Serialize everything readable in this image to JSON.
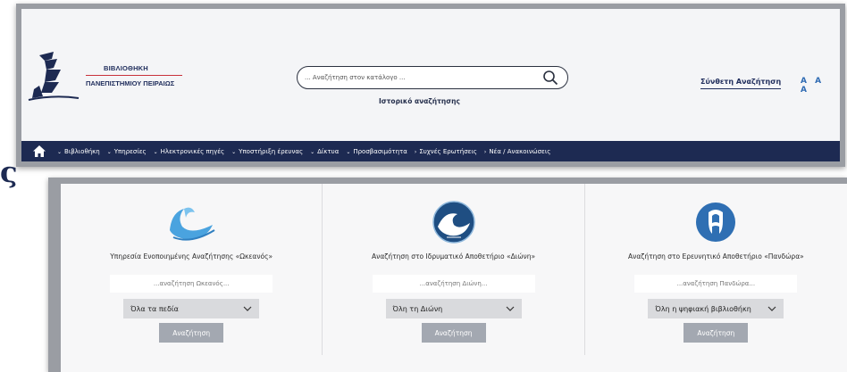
{
  "header": {
    "logo_line1": "ΒΙΒΛΙΟΘΗΚΗ",
    "logo_line2": "ΠΑΝΕΠΙΣΤΗΜΙΟΥ ΠΕΙΡΑΙΩΣ",
    "search_placeholder": "... Αναζήτηση στον κατάλογο ...",
    "history_link": "Ιστορικό αναζήτησης",
    "advanced_search": "Σύνθετη Αναζήτηση",
    "font_sizes": [
      "A",
      "A",
      "A"
    ],
    "accent_color": "#2f6bb3",
    "brand_color": "#1d2a52"
  },
  "nav": {
    "items": [
      {
        "label": "Βιβλιοθήκη",
        "chevron": "⌄"
      },
      {
        "label": "Υπηρεσίες",
        "chevron": "⌄"
      },
      {
        "label": "Ηλεκτρονικές πηγές",
        "chevron": "⌄"
      },
      {
        "label": "Υποστήριξη έρευνας",
        "chevron": "⌄"
      },
      {
        "label": "Δίκτυα",
        "chevron": "⌄"
      },
      {
        "label": "Προσβασιμότητα",
        "chevron": "⌄"
      },
      {
        "label": "Συχνές Ερωτήσεις",
        "chevron": "›"
      },
      {
        "label": "Νέα / Ανακοινώσεις",
        "chevron": "›"
      }
    ]
  },
  "stray_letter": "ς",
  "panels": [
    {
      "title": "Υπηρεσία Ενοποιημένης Αναζήτησης «Ωκεανός»",
      "placeholder": "...αναζήτηση Ωκεανός...",
      "select_value": "Όλα τα πεδία",
      "button": "Αναζήτηση",
      "icon": "wave-logo-icon"
    },
    {
      "title": "Αναζήτηση στο Ιδρυματικό Αποθετήριο «Διώνη»",
      "placeholder": "...αναζήτηση Διώνη...",
      "select_value": "Όλη τη Διώνη",
      "button": "Αναζήτηση",
      "icon": "dione-logo-icon"
    },
    {
      "title": "Αναζήτηση στο Ερευνητικό Αποθετήριο «Πανδώρα»",
      "placeholder": "...αναζήτηση Πανδώρα...",
      "select_value": "Όλη η ψηφιακή βιβλιοθήκη",
      "button": "Αναζήτηση",
      "icon": "pandora-logo-icon"
    }
  ]
}
